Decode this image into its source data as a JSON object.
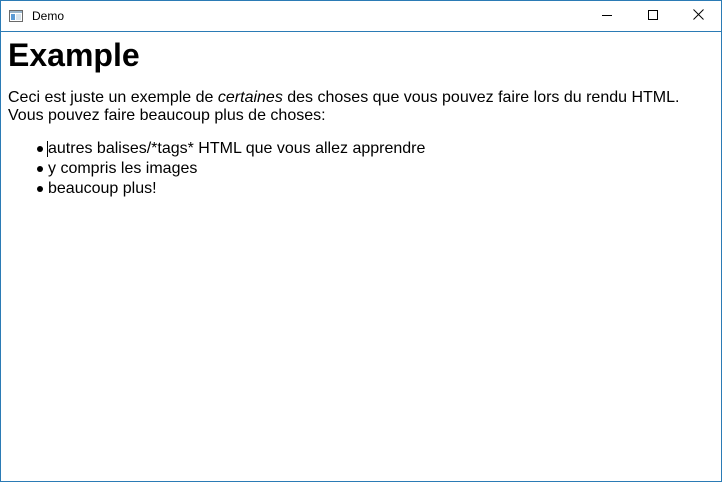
{
  "window": {
    "title": "Demo",
    "buttons": {
      "minimize_icon": "minimize-icon",
      "maximize_icon": "maximize-icon",
      "close_icon": "close-icon"
    },
    "border_color": "#2b7bb5"
  },
  "document": {
    "heading": "Example",
    "paragraph": {
      "before": "Ceci est juste un exemple de ",
      "emphasis": "certaines",
      "after": " des choses que vous pouvez faire lors du rendu HTML. Vous pouvez faire beaucoup plus de choses:"
    },
    "list": [
      "autres balises/*tags* HTML que vous allez apprendre",
      "y compris les images",
      "beaucoup plus!"
    ]
  }
}
